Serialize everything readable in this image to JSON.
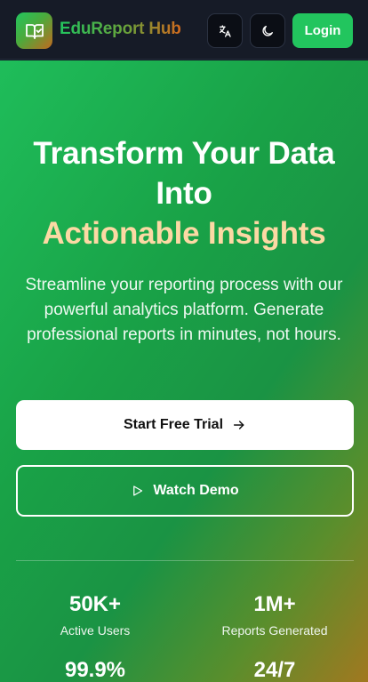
{
  "navbar": {
    "brand": "EduReport Hub",
    "login_label": "Login",
    "translate_icon": "translate-icon",
    "theme_icon": "moon-icon",
    "logo_icon": "book-check-icon"
  },
  "hero": {
    "title_line1": "Transform Your Data",
    "title_line2": "Into",
    "title_accent": "Actionable Insights",
    "subtitle": "Streamline your reporting process with our powerful analytics platform. Generate professional reports in minutes, not hours.",
    "primary_cta": "Start Free Trial",
    "secondary_cta": "Watch Demo"
  },
  "stats": [
    {
      "value": "50K+",
      "label": "Active Users"
    },
    {
      "value": "1M+",
      "label": "Reports Generated"
    },
    {
      "value": "99.9%",
      "label": ""
    },
    {
      "value": "24/7",
      "label": ""
    }
  ],
  "colors": {
    "accent_green": "#22c55e",
    "accent_orange": "#d2691e",
    "title_highlight": "#fcd9a4",
    "navbar_bg": "#161b27"
  }
}
